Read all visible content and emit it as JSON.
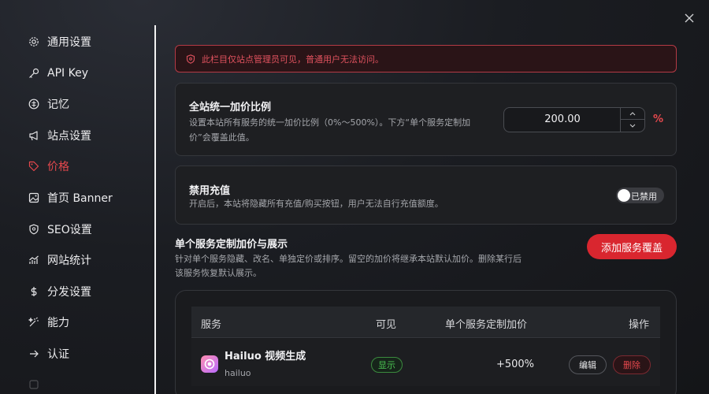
{
  "sidebar": {
    "items": [
      {
        "label": "通用设置",
        "icon": "gear-icon"
      },
      {
        "label": "API Key",
        "icon": "key-icon"
      },
      {
        "label": "记忆",
        "icon": "memory-icon"
      },
      {
        "label": "站点设置",
        "icon": "megaphone-icon"
      },
      {
        "label": "价格",
        "icon": "tag-icon",
        "active": true
      },
      {
        "label": "首页 Banner",
        "icon": "image-icon"
      },
      {
        "label": "SEO设置",
        "icon": "shield-icon"
      },
      {
        "label": "网站统计",
        "icon": "chart-icon"
      },
      {
        "label": "分发设置",
        "icon": "dollar-icon"
      },
      {
        "label": "能力",
        "icon": "wand-icon"
      },
      {
        "label": "认证",
        "icon": "arrow-right-icon"
      }
    ]
  },
  "alert": {
    "text": "此栏目仅站点管理员可见，普通用户无法访问。"
  },
  "markup_card": {
    "title": "全站统一加价比例",
    "desc": "设置本站所有服务的统一加价比例（0%～500%）。下方“单个服务定制加价”会覆盖此值。",
    "value": "200.00",
    "unit": "%"
  },
  "recharge_card": {
    "title": "禁用充值",
    "desc": "开启后，本站将隐藏所有充值/购买按钮，用户无法自行充值额度。",
    "toggle_label": "已禁用"
  },
  "overrides": {
    "title": "单个服务定制加价与展示",
    "desc": "针对单个服务隐藏、改名、单独定价或排序。留空的加价将继承本站默认加价。删除某行后该服务恢复默认展示。",
    "add_button": "添加服务覆盖",
    "columns": [
      "服务",
      "可见",
      "单个服务定制加价",
      "操作"
    ],
    "rows": [
      {
        "name": "Hailuo 视频生成",
        "id": "hailuo",
        "visible": "显示",
        "markup": "+500%",
        "edit": "编辑",
        "delete": "删除"
      }
    ]
  },
  "colors": {
    "accent": "#e5484d",
    "add_button": "#d9262f",
    "visible_badge": "#4cc653"
  }
}
